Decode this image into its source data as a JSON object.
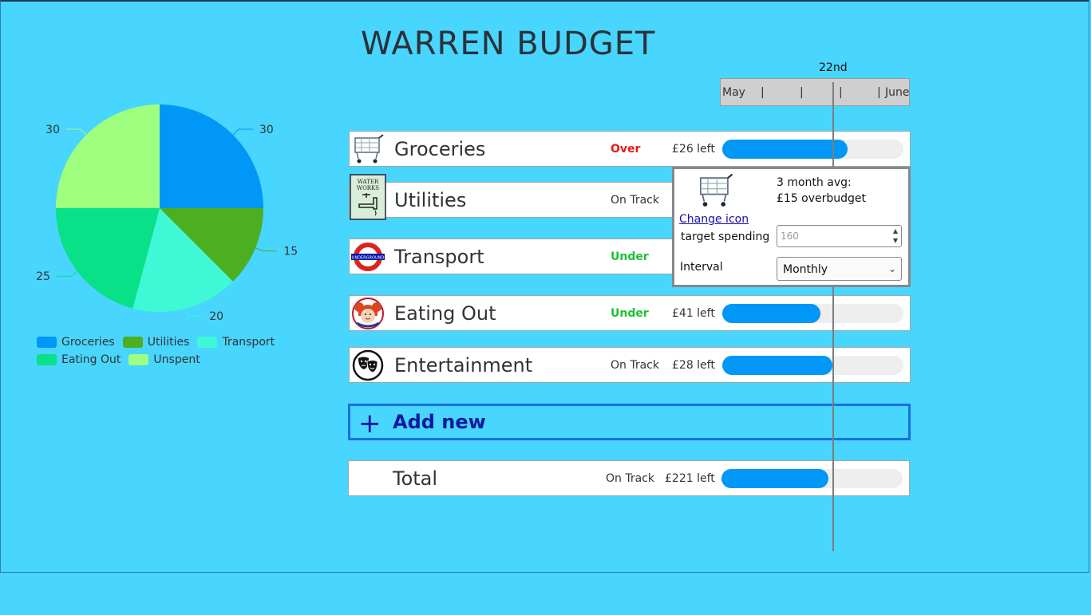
{
  "app": {
    "title": "WARREN BUDGET"
  },
  "timeline": {
    "marker_label": "22nd",
    "start_label": "May",
    "end_label": "June",
    "tick": "|"
  },
  "chart_data": {
    "type": "pie",
    "slices": [
      {
        "label": "Groceries",
        "value": 30,
        "color": "#0197f6"
      },
      {
        "label": "Utilities",
        "value": 15,
        "color": "#4caf1f"
      },
      {
        "label": "Transport",
        "value": 20,
        "color": "#3ef8d6"
      },
      {
        "label": "Eating Out",
        "value": 25,
        "color": "#08e187"
      },
      {
        "label": "Unspent",
        "value": 30,
        "color": "#9fff7f"
      }
    ],
    "legend": [
      "Groceries",
      "Utilities",
      "Transport",
      "Eating Out",
      "Unspent"
    ],
    "legend_position": "bottom"
  },
  "categories": [
    {
      "name": "Groceries",
      "status": "Over",
      "left": "£26 left",
      "fill": 0.69,
      "icon": "shopping-cart-icon"
    },
    {
      "name": "Utilities",
      "status": "On Track",
      "left": "",
      "fill": 0,
      "icon": "water-works-icon"
    },
    {
      "name": "Transport",
      "status": "Under",
      "left": "",
      "fill": 0,
      "icon": "underground-icon"
    },
    {
      "name": "Eating Out",
      "status": "Under",
      "left": "£41 left",
      "fill": 0.54,
      "icon": "wendys-icon"
    },
    {
      "name": "Entertainment",
      "status": "On Track",
      "left": "£28 left",
      "fill": 0.61,
      "icon": "theatre-masks-icon"
    }
  ],
  "add_new": {
    "plus": "+",
    "label": "Add new"
  },
  "total": {
    "name": "Total",
    "status": "On Track",
    "left": "£221 left",
    "fill": 0.59
  },
  "popup": {
    "avg_line1": "3 month avg:",
    "avg_line2": "£15 overbudget",
    "change_icon": "Change icon",
    "target_label": "target spending",
    "target_placeholder": "160",
    "interval_label": "Interval",
    "interval_value": "Monthly"
  },
  "colors": {
    "background": "#48d5fe",
    "bar": "#0197f6",
    "over": "#e8191b",
    "under": "#1cc233"
  }
}
